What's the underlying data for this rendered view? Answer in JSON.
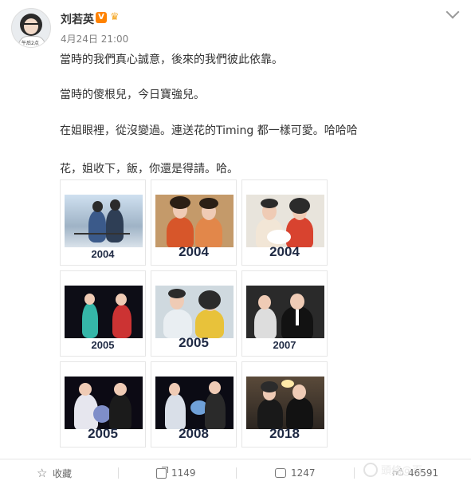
{
  "post": {
    "username": "刘若英",
    "verified_badge": "V",
    "time": "4月24日 21:00",
    "paragraphs": [
      "當時的我們真心誠意，後來的我們彼此依靠。",
      "當時的傻根兒，今日寶強兒。",
      "在姐眼裡，從沒變過。連送花的Timing 都一樣可愛。哈哈哈",
      "花，姐收下，飯，你還是得請。哈。"
    ],
    "avatar_caption": "午后2点"
  },
  "photos": [
    {
      "year": "2004",
      "style": "small"
    },
    {
      "year": "2004",
      "style": "big"
    },
    {
      "year": "2004",
      "style": "big"
    },
    {
      "year": "2005",
      "style": "small"
    },
    {
      "year": "2005",
      "style": "big"
    },
    {
      "year": "2007",
      "style": "small"
    },
    {
      "year": "2005",
      "style": "big"
    },
    {
      "year": "2008",
      "style": "big"
    },
    {
      "year": "2018",
      "style": "big"
    }
  ],
  "actions": {
    "favorite_label": "收藏",
    "repost_count": "1149",
    "comment_count": "1247",
    "like_count": "46591"
  },
  "watermark": {
    "text": "頭條@百"
  },
  "colors": {
    "accent": "#ff8200",
    "text": "#333333",
    "muted": "#808080"
  }
}
